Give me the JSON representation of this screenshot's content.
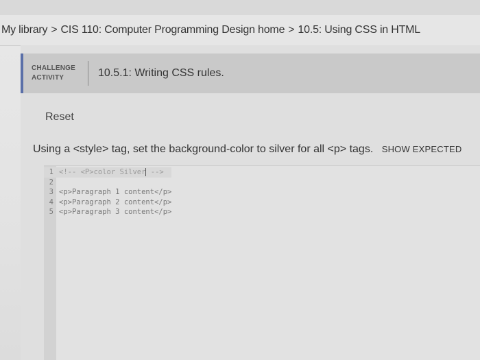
{
  "breadcrumb": {
    "items": [
      "My library",
      "CIS 110: Computer Programming Design home",
      "10.5: Using CSS in HTML"
    ],
    "separator": ">"
  },
  "challenge": {
    "label_line1": "CHALLENGE",
    "label_line2": "ACTIVITY",
    "title": "10.5.1: Writing CSS rules."
  },
  "reset_label": "Reset",
  "prompt": {
    "text": "Using a <style> tag, set the background-color to silver for all <p> tags.",
    "show_expected_label": "SHOW EXPECTED"
  },
  "editor": {
    "lines": [
      {
        "num": "1",
        "text": "<!-- <P>color Silver"
      },
      {
        "num": "2",
        "text": ""
      },
      {
        "num": "3",
        "text": "<p>Paragraph 1 content</p>"
      },
      {
        "num": "4",
        "text": "<p>Paragraph 2 content</p>"
      },
      {
        "num": "5",
        "text": "<p>Paragraph 3 content</p>"
      }
    ],
    "line1_tail": " -->"
  },
  "colors": {
    "accent": "#5a6fa8"
  }
}
